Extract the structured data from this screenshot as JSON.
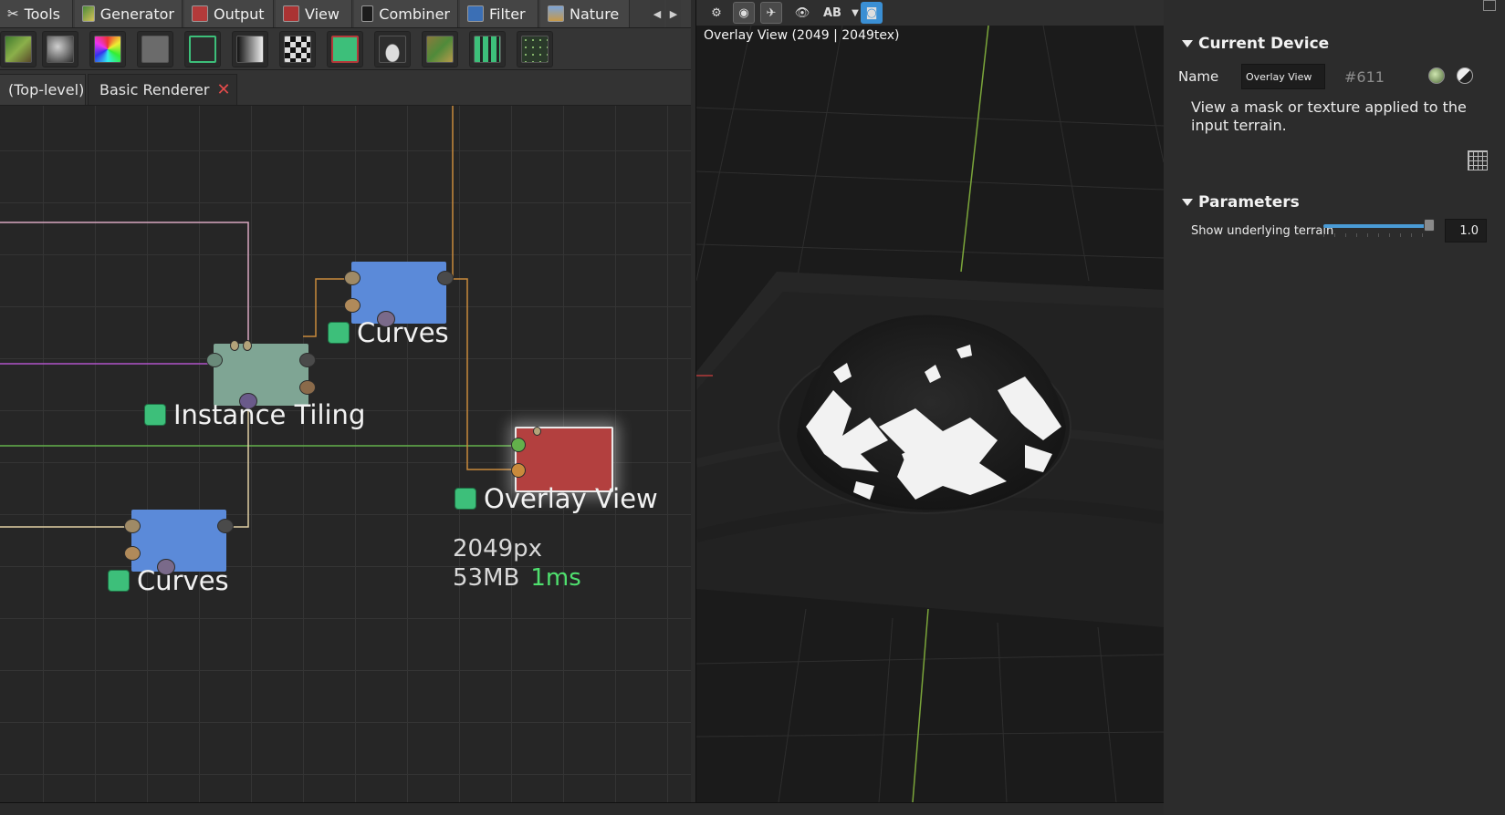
{
  "colors": {
    "accent_blue": "#4a9bd6",
    "status_green": "#3dbf7a",
    "timing_green": "#4fe06e",
    "curves_node": "#5b8ad9",
    "tiling_node": "#7fa594",
    "overlay_node": "#b3403f",
    "wire_orange": "#c98a3c",
    "wire_pink": "#d8a7c0",
    "wire_purple": "#b054c9",
    "wire_green": "#63b04b",
    "wire_cream": "#e0cfa4"
  },
  "category_tabs": [
    {
      "label": "Tools",
      "icon": "tools-icon"
    },
    {
      "label": "Generator",
      "icon": "generator-icon"
    },
    {
      "label": "Output",
      "icon": "output-icon"
    },
    {
      "label": "View",
      "icon": "view-icon"
    },
    {
      "label": "Combiner",
      "icon": "combiner-icon"
    },
    {
      "label": "Filter",
      "icon": "filter-icon"
    },
    {
      "label": "Nature",
      "icon": "nature-icon"
    }
  ],
  "doc_tabs": {
    "top_level": "(Top-level)",
    "basic_renderer": "Basic Renderer",
    "close_glyph": "✕"
  },
  "nodes": {
    "curves_top": {
      "label": "Curves"
    },
    "instance_tiling": {
      "label": "Instance Tiling"
    },
    "overlay_view": {
      "label": "Overlay View",
      "resolution": "2049px",
      "memory": "53MB",
      "time": "1ms"
    },
    "curves_bottom": {
      "label": "Curves"
    }
  },
  "view": {
    "caption": "Overlay View (2049 | 2049tex)",
    "ab_label": "AB"
  },
  "properties": {
    "current_device": {
      "header": "Current Device",
      "name_label": "Name",
      "name_value": "Overlay View",
      "device_id": "#611",
      "description": "View a mask or texture applied to the input terrain."
    },
    "parameters": {
      "header": "Parameters",
      "show_terrain_label": "Show underlying terrain",
      "show_terrain_value": "1.0",
      "show_terrain_fraction": 1.0
    }
  }
}
